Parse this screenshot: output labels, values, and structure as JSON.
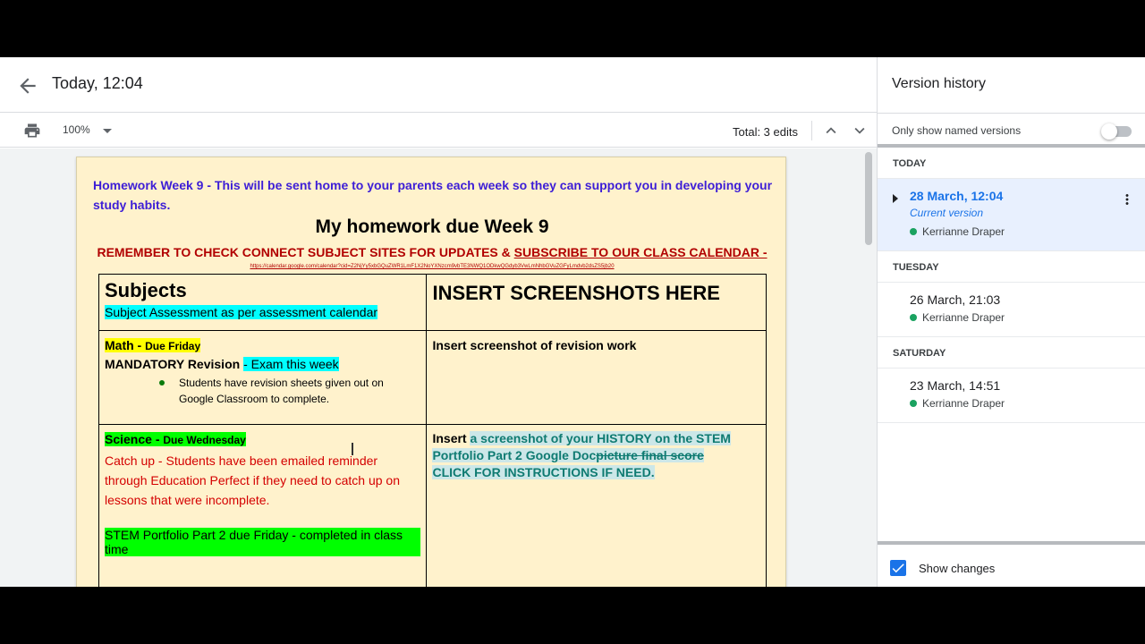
{
  "header": {
    "title": "Today, 12:04"
  },
  "toolbar": {
    "zoom": "100%",
    "edits_label": "Total: 3 edits"
  },
  "document": {
    "intro": "Homework Week 9 - This will be sent home to your parents each week so they can support you in developing your study habits.",
    "heading": "My homework due Week 9",
    "remember_prefix": "REMEMBER TO CHECK CONNECT SUBJECT SITES FOR UPDATES & ",
    "remember_link": "SUBSCRIBE TO OUR CLASS CALENDAR -",
    "calendar_url": "https://calendar.google.com/calendar?cid=Z2NjYy5xbGQuZWR1LmF1X2NoYXNzcm9vbTE3NWQ1ODkwQGdyb3VwLmNhbGVuZGFyLmdvb2dsZS5jb20",
    "table": {
      "r1": {
        "subjects_heading": "Subjects",
        "assessment_note": "Subject Assessment as per assessment calendar",
        "insert_heading": "INSERT SCREENSHOTS HERE"
      },
      "r2": {
        "math_label": "Math - ",
        "math_due": "Due Friday",
        "mandatory": "MANDATORY Revision ",
        "exam": "- Exam this week",
        "bullet": "Students have revision sheets given out on Google Classroom to complete.",
        "insert_text": "Insert screenshot of revision work"
      },
      "r3": {
        "science_label": "Science - ",
        "science_due": "Due Wednesday",
        "catch_up": "Catch up - Students have been emailed reminder through Education Perfect if they need to catch up on lessons that were incomplete.",
        "stem": "STEM Portfolio Part 2 due Friday - completed in class time",
        "insert_word": "Insert ",
        "insert_teal": "a screenshot of your HISTORY on the STEM Portfolio Part 2 Google Doc",
        "insert_struck": "picture final score",
        "instructions": "CLICK FOR INSTRUCTIONS IF NEED."
      }
    }
  },
  "version_history": {
    "title": "Version history",
    "named_only_label": "Only show named versions",
    "named_only_on": false,
    "groups": [
      {
        "label": "TODAY",
        "versions": [
          {
            "timestamp": "28 March, 12:04",
            "note": "Current version",
            "author": "Kerrianne Draper"
          }
        ]
      },
      {
        "label": "TUESDAY",
        "versions": [
          {
            "timestamp": "26 March, 21:03",
            "author": "Kerrianne Draper"
          }
        ]
      },
      {
        "label": "SATURDAY",
        "versions": [
          {
            "timestamp": "23 March, 14:51",
            "author": "Kerrianne Draper"
          }
        ]
      }
    ],
    "show_changes_label": "Show changes",
    "show_changes_checked": true
  },
  "colors": {
    "accent": "#1a73e8",
    "page_bg": "#fff2cc",
    "intro_text": "#3d1ed6",
    "alert_text": "#b10000",
    "author_dot": "#1aa260"
  },
  "icons": [
    "back-arrow-icon",
    "print-icon",
    "chevron-down-icon",
    "chevron-up-icon",
    "caret-right-icon",
    "more-vert-icon",
    "checkmark-icon",
    "text-cursor-icon"
  ]
}
